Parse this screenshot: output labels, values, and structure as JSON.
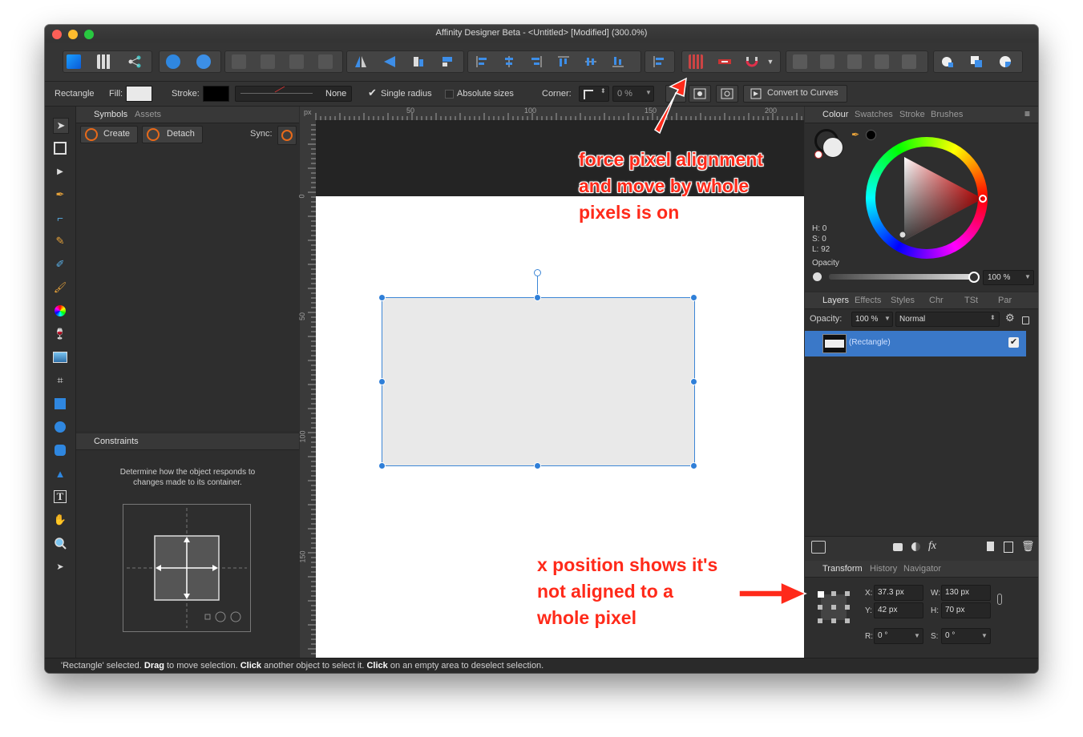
{
  "window": {
    "title": "Affinity Designer Beta - <Untitled> [Modified] (300.0%)"
  },
  "context_toolbar": {
    "shape_label": "Rectangle",
    "fill_label": "Fill:",
    "stroke_label": "Stroke:",
    "stroke_style_value": "None",
    "single_radius_label": "Single radius",
    "absolute_sizes_label": "Absolute sizes",
    "corner_label": "Corner:",
    "corner_value": "0 %",
    "convert_label": "Convert to Curves"
  },
  "symbols_panel": {
    "tabs": [
      "Symbols",
      "Assets"
    ],
    "create_label": "Create",
    "detach_label": "Detach",
    "sync_label": "Sync:"
  },
  "constraints_panel": {
    "title": "Constraints",
    "description_line1": "Determine how the object responds to",
    "description_line2": "changes made to its container."
  },
  "ruler": {
    "unit": "px",
    "h_labels": [
      "50",
      "100",
      "150",
      "200"
    ],
    "v_labels": [
      "0",
      "50",
      "100",
      "150"
    ]
  },
  "colour_panel": {
    "tabs": [
      "Colour",
      "Swatches",
      "Stroke",
      "Brushes"
    ],
    "h": "H: 0",
    "s": "S: 0",
    "l": "L: 92",
    "opacity_label": "Opacity",
    "opacity_value": "100 %"
  },
  "layers_panel": {
    "tabs": [
      "Layers",
      "Effects",
      "Styles",
      "Chr",
      "TSt",
      "Par"
    ],
    "opacity_label": "Opacity:",
    "opacity_value": "100 %",
    "blend_mode": "Normal",
    "layer_name": "(Rectangle)"
  },
  "transform_panel": {
    "tabs": [
      "Transform",
      "History",
      "Navigator"
    ],
    "x_label": "X:",
    "x_value": "37.3 px",
    "y_label": "Y:",
    "y_value": "42 px",
    "w_label": "W:",
    "w_value": "130 px",
    "h_label": "H:",
    "h_value": "70 px",
    "r_label": "R:",
    "r_value": "0 °",
    "s_label": "S:",
    "s_value": "0 °"
  },
  "status": {
    "part1": "'Rectangle' selected. ",
    "bold1": "Drag",
    "part2": " to move selection. ",
    "bold2": "Click",
    "part3": " another object to select it. ",
    "bold3": "Click",
    "part4": " on an empty area to deselect selection."
  },
  "annotations": {
    "top_line1": "force pixel alignment",
    "top_line2": "and move by whole",
    "top_line3": "pixels is on",
    "bottom_line1": "x position shows it's",
    "bottom_line2": "not aligned to a",
    "bottom_line3": "whole pixel"
  },
  "colors": {
    "accent": "#2f7fd8",
    "annotation": "#ff2a1a",
    "selection_layer": "#3a78c8",
    "shape_fill": "#e9e9e9"
  }
}
